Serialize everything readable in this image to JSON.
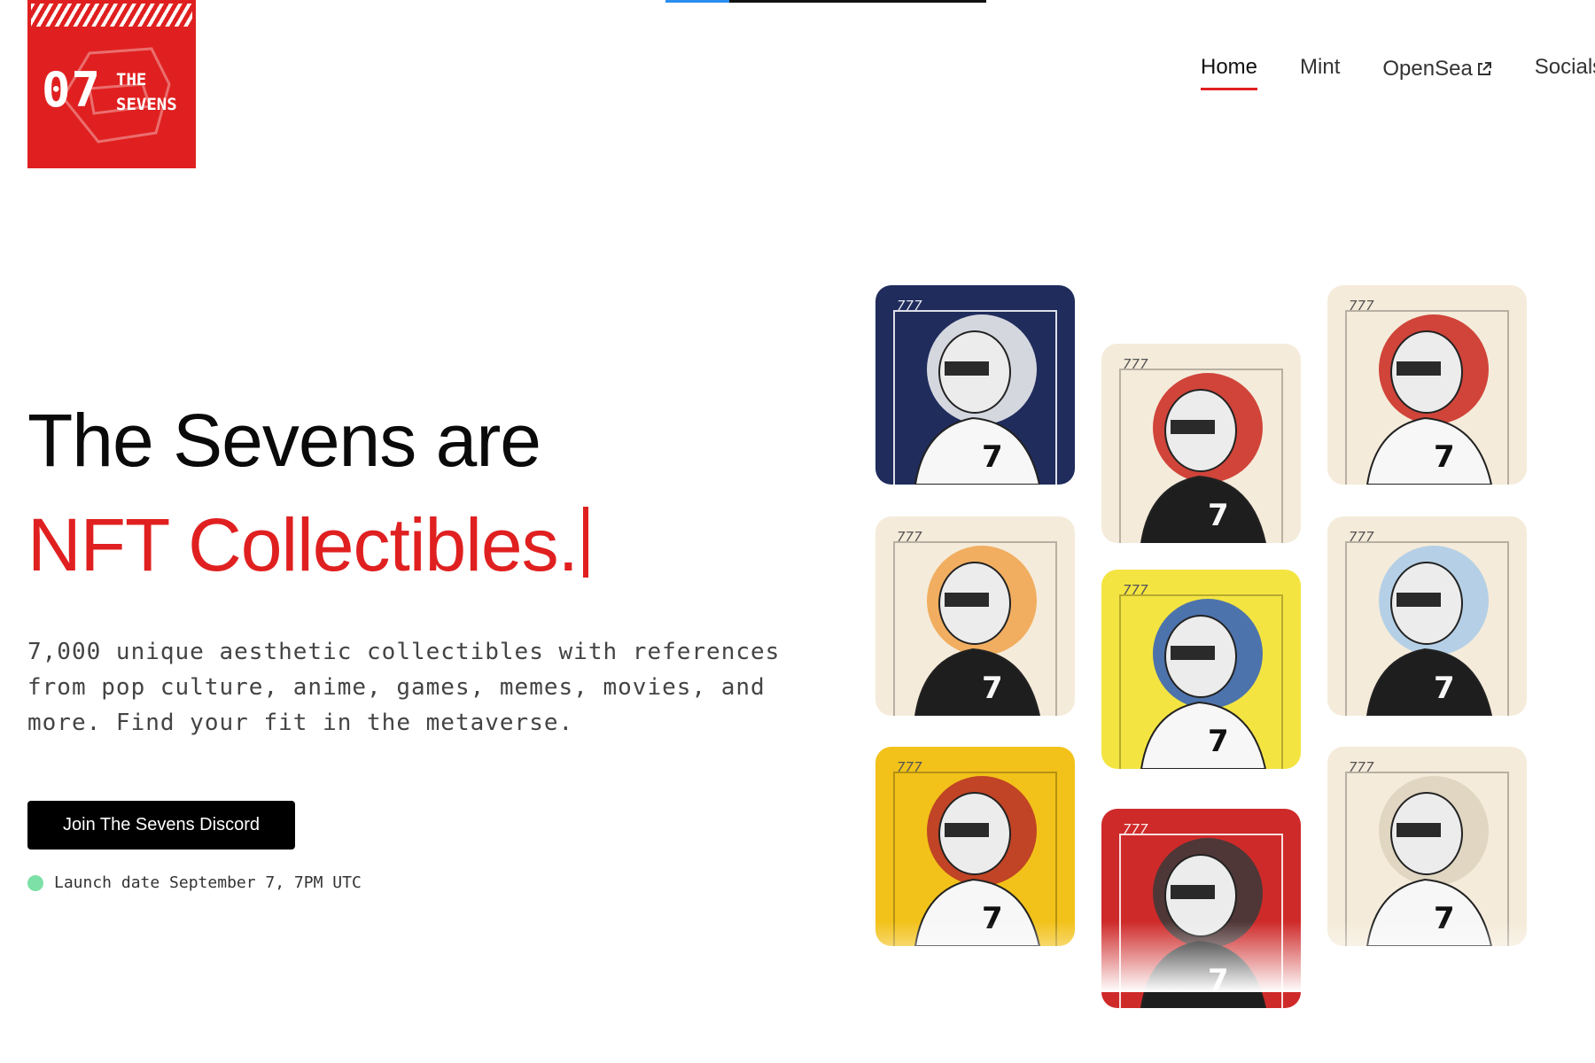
{
  "logo": {
    "number": "07",
    "name_line1": "THE",
    "name_line2": "SEVENS"
  },
  "nav": {
    "items": [
      {
        "label": "Home",
        "active": true
      },
      {
        "label": "Mint",
        "active": false
      },
      {
        "label": "OpenSea",
        "active": false,
        "external": true
      },
      {
        "label": "Socials",
        "active": false
      }
    ]
  },
  "hero": {
    "headline_line1": "The Sevens are",
    "headline_line2": "NFT Collectibles.",
    "description": "7,000 unique aesthetic collectibles with references from pop culture, anime, games, memes, movies, and more. Find your fit in the metaverse.",
    "cta_label": "Join The Sevens Discord",
    "launch_text": "Launch date September 7, 7PM UTC",
    "status_color": "#7de0a6"
  },
  "gallery": {
    "tag": "777",
    "cards": [
      {
        "background": "#1f2c5c",
        "accent": "#f6f6f6",
        "mask": "kitsune-mask"
      },
      {
        "background": "#f5ebda",
        "accent": "#c9271d",
        "mask": "gas-mask"
      },
      {
        "background": "#f5ebda",
        "accent": "#c9271d",
        "mask": "skull"
      },
      {
        "background": "#f5ebda",
        "accent": "#f0a34a",
        "mask": "shiba-head"
      },
      {
        "background": "#f4e441",
        "accent": "#2f5fc0",
        "mask": "kitsune-mask"
      },
      {
        "background": "#f5ebda",
        "accent": "#a9cbe8",
        "mask": "helmet"
      },
      {
        "background": "#f2c21a",
        "accent": "#b72e28",
        "mask": "crow-helmet"
      },
      {
        "background": "#cf2a2a",
        "accent": "#3a3a3a",
        "mask": "crow-helmet"
      },
      {
        "background": "#f5ebda",
        "accent": "#dcd2bc",
        "mask": "cap-mask"
      }
    ]
  },
  "colors": {
    "brand_red": "#e02020",
    "button": "#000000",
    "progress_accent": "#2b8ef0"
  }
}
